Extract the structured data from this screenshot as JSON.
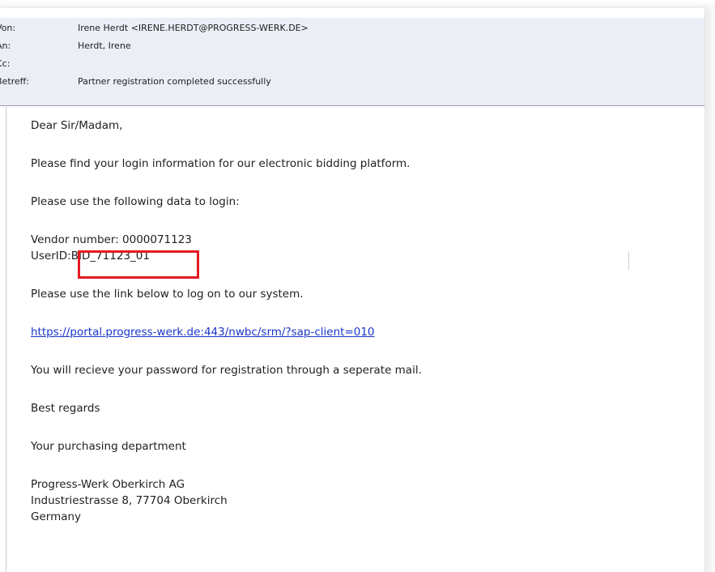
{
  "email": {
    "header": {
      "from_label": "Von:",
      "from_value": "Irene Herdt <IRENE.HERDT@PROGRESS-WERK.DE>",
      "to_label": "An:",
      "to_value": "Herdt, Irene",
      "cc_label": "Cc:",
      "cc_value": "",
      "subject_label": "Betreff:",
      "subject_value": "Partner registration completed successfully"
    },
    "body": {
      "greeting": "Dear Sir/Madam,",
      "intro": "Please find your login information for our electronic bidding platform.",
      "data_intro": "Please use the following data to login:",
      "vendor_line": "Vendor number: 0000071123",
      "userid_label": "UserID:",
      "userid_value": "BID_71123_01",
      "link_intro": "Please use the link below to log on to our system.",
      "link": "https://portal.progress-werk.de:443/nwbc/srm/?sap-client=010",
      "password_note": "You will recieve your password for registration through a seperate mail.",
      "regards": "Best regards",
      "department": "Your purchasing department",
      "company": "Progress-Werk Oberkirch AG",
      "address": "Industriestrasse 8, 77704 Oberkirch",
      "country": "Germany"
    }
  },
  "colors": {
    "header_bg": "#eceef6",
    "link": "#1a35c9",
    "highlight": "#e31b23"
  }
}
